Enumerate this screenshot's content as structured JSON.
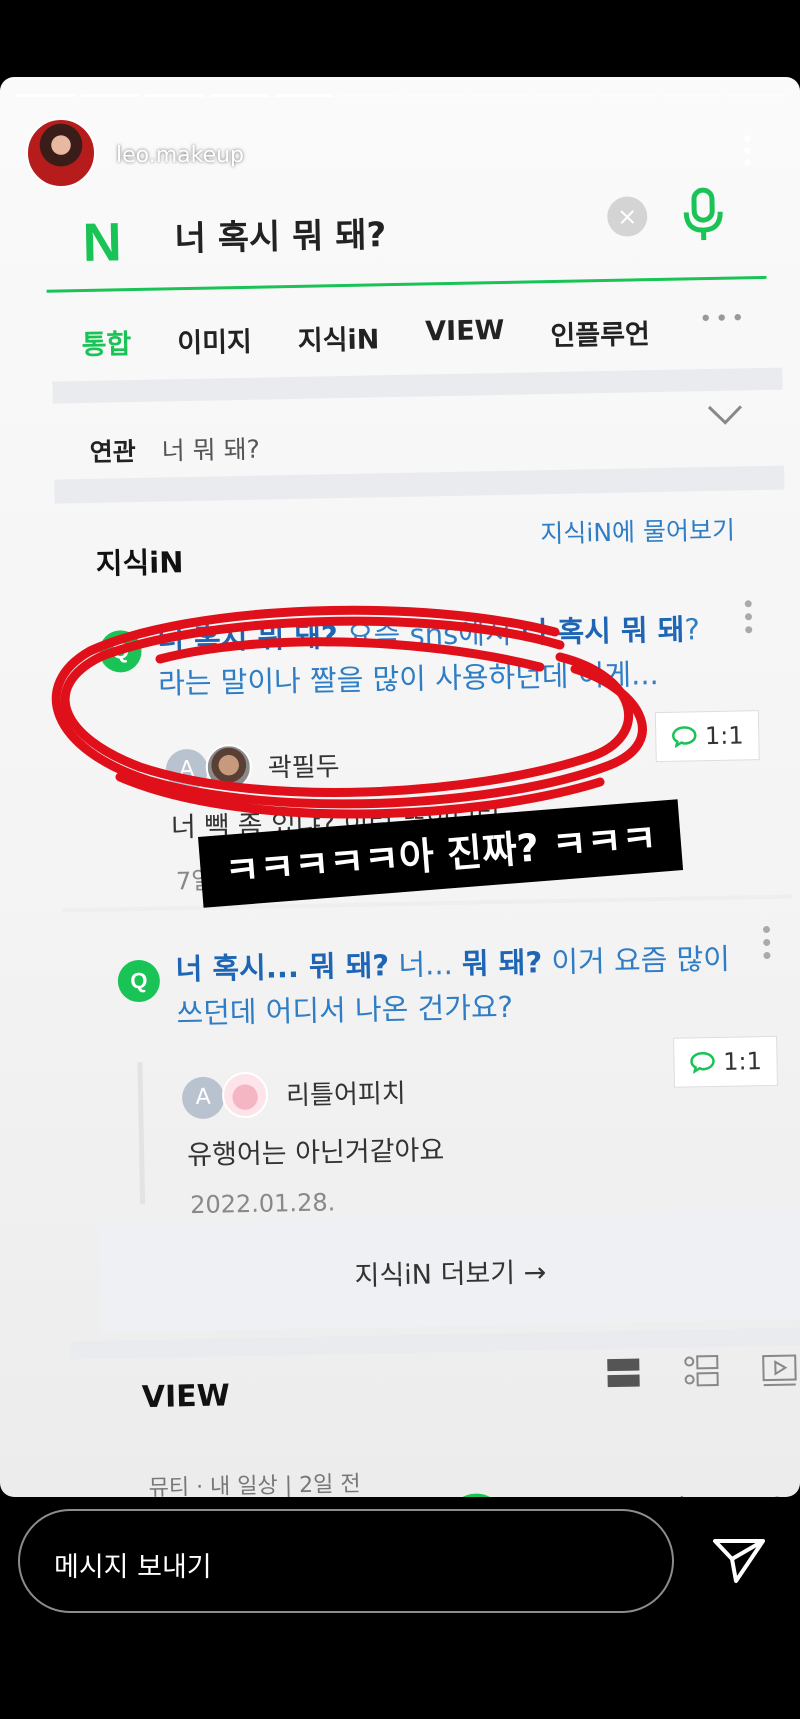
{
  "story": {
    "username": "leo.makeup",
    "time_ago": "",
    "progress_segments": 12,
    "progress_done": 5,
    "reply_placeholder": "메시지 보내기"
  },
  "browser": {
    "search_query": "너 혹시 뭐 돼?",
    "logo": "N",
    "clear": "×",
    "tabs": [
      "통합",
      "이미지",
      "지식iN",
      "VIEW",
      "인플루언"
    ],
    "tabs_more": "•••",
    "related_label": "연관",
    "related_value": "너 뭐 돼?",
    "section_title": "지식iN",
    "ask_link": "지식iN에 물어보기",
    "results": [
      {
        "q_badge": "Q",
        "q_bold_1": "너 혹시 뭐 돼?",
        "q_rest_1": " 요즘 sns에서 ",
        "q_bold_2": "너 혹시 뭐 돼",
        "q_rest_2": "?라는 말이나 짤을 많이 사용하던데 이게...",
        "ratio": "1:1",
        "avatar_letter": "A",
        "answerer": "곽필두",
        "answer": "너 빽 좀 있냐? 이런 뜻입니당",
        "date": "7일 전"
      },
      {
        "q_badge": "Q",
        "q_bold_1": "너 혹시... 뭐 돼?",
        "q_rest_1": " 너... ",
        "q_bold_2": "뭐 돼?",
        "q_rest_2": " 이거 요즘 많이 쓰던데 어디서 나온 건가요?",
        "ratio": "1:1",
        "avatar_letter": "A",
        "answerer": "리틀어피치",
        "answer": "유행어는 아닌거같아요",
        "date": "2022.01.28."
      }
    ],
    "more_label": "지식iN 더보기 →",
    "view_title": "VIEW",
    "view_peek": "뮤티 · 내 일상 | 2일 전"
  },
  "annotation": {
    "caption": "ㅋㅋㅋㅋㅋ아 진짜? ㅋㅋㅋ",
    "scribble_color": "#e0101a"
  },
  "colors": {
    "naver_green": "#19c355",
    "link_blue": "#2f7dc4"
  }
}
